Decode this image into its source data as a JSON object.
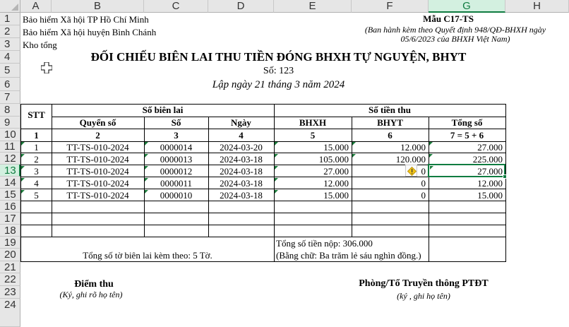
{
  "columns": [
    "A",
    "B",
    "C",
    "D",
    "E",
    "F",
    "G",
    "H"
  ],
  "selected_column": "G",
  "rows": [
    "1",
    "2",
    "3",
    "4",
    "5",
    "6",
    "7",
    "8",
    "9",
    "10",
    "11",
    "12",
    "13",
    "14",
    "15",
    "16",
    "17",
    "18",
    "19",
    "20",
    "21",
    "22",
    "23",
    "24"
  ],
  "selected_row": "13",
  "header": {
    "org1": "Bảo hiểm Xã hội TP Hồ Chí Minh",
    "org2": "Bảo hiểm Xã hội huyện Bình Chánh",
    "org3": "Kho tổng",
    "form_code": "Mẫu C17-TS",
    "form_note1": "(Ban hành kèm theo Quyết định 948/QĐ-BHXH ngày",
    "form_note2": "05/6/2023 của BHXH Việt Nam)",
    "title": "ĐỐI CHIẾU BIÊN LAI THU TIỀN ĐÓNG BHXH TỰ NGUYỆN, BHYT",
    "number": "Số: 123",
    "date_line": "Lập ngày 21 tháng 3 năm 2024"
  },
  "table": {
    "stt": "STT",
    "receipt_group": "Số biên lai",
    "amount_group": "Số tiền thu",
    "col_book": "Quyển số",
    "col_no": "Số",
    "col_date": "Ngày",
    "col_bhxh": "BHXH",
    "col_bhyt": "BHYT",
    "col_total": "Tổng số",
    "idx": [
      "1",
      "2",
      "3",
      "4",
      "5",
      "6",
      "7 = 5 + 6"
    ],
    "rows": [
      {
        "stt": "1",
        "book": "TT-TS-010-2024",
        "no": "0000014",
        "date": "2024-03-20",
        "bhxh": "15.000",
        "bhyt": "12.000",
        "total": "27.000"
      },
      {
        "stt": "2",
        "book": "TT-TS-010-2024",
        "no": "0000013",
        "date": "2024-03-18",
        "bhxh": "105.000",
        "bhyt": "120.000",
        "total": "225.000"
      },
      {
        "stt": "3",
        "book": "TT-TS-010-2024",
        "no": "0000012",
        "date": "2024-03-18",
        "bhxh": "27.000",
        "bhyt": "0",
        "total": "27.000"
      },
      {
        "stt": "4",
        "book": "TT-TS-010-2024",
        "no": "0000011",
        "date": "2024-03-18",
        "bhxh": "12.000",
        "bhyt": "0",
        "total": "12.000"
      },
      {
        "stt": "5",
        "book": "TT-TS-010-2024",
        "no": "0000010",
        "date": "2024-03-18",
        "bhxh": "15.000",
        "bhyt": "0",
        "total": "15.000"
      }
    ],
    "sheet_count": "Tổng số tờ biên lai kèm theo: 5 Tờ.",
    "total_paid": "Tổng số tiền nộp: 306.000",
    "total_words": "(Bằng chữ: Ba trăm lẻ sáu nghìn đồng.)"
  },
  "signatures": {
    "left_title": "Điểm thu",
    "left_note": "(Ký, ghi rõ họ tên)",
    "right_title": "Phòng/Tổ Truyền thông PTĐT",
    "right_note": "(ký , ghi họ tên)"
  },
  "icons": {
    "warning": "warning-diamond-icon",
    "cursor": "plus-cursor-icon"
  },
  "colors": {
    "accent": "#107c41",
    "header_bg": "#e6e6e6",
    "warning": "#f0c419"
  }
}
